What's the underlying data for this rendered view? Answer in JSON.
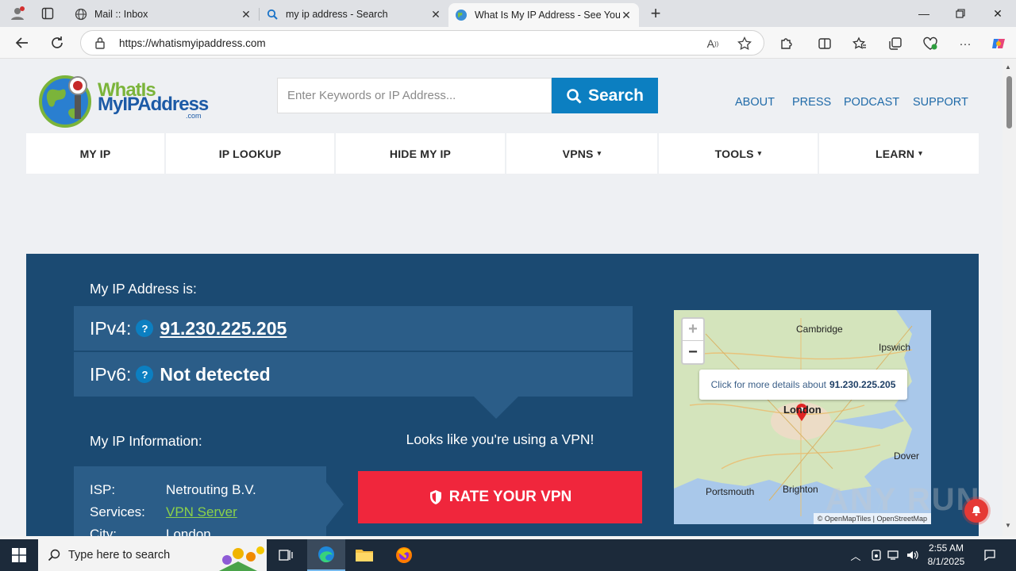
{
  "browser": {
    "tabs": [
      {
        "title": "Mail :: Inbox",
        "active": false
      },
      {
        "title": "my ip address - Search",
        "active": false
      },
      {
        "title": "What Is My IP Address - See Your",
        "active": true
      }
    ],
    "url": "https://whatismyipaddress.com"
  },
  "site": {
    "logo": {
      "line1": "WhatIs",
      "line2": "MyIPAddress",
      "line3": ".com"
    },
    "search": {
      "placeholder": "Enter Keywords or IP Address...",
      "button_label": "Search"
    },
    "top_links": [
      "ABOUT",
      "PRESS",
      "PODCAST",
      "SUPPORT"
    ],
    "nav": [
      {
        "label": "MY IP",
        "caret": false
      },
      {
        "label": "IP LOOKUP",
        "caret": false
      },
      {
        "label": "HIDE MY IP",
        "caret": false
      },
      {
        "label": "VPNS",
        "caret": true
      },
      {
        "label": "TOOLS",
        "caret": true
      },
      {
        "label": "LEARN",
        "caret": true
      }
    ],
    "caret_glyph": "▾"
  },
  "hero": {
    "heading": "My IP Address is:",
    "ipv4_label": "IPv4:",
    "ipv4_value": "91.230.225.205",
    "ipv6_label": "IPv6:",
    "ipv6_value": "Not detected",
    "help_glyph": "?",
    "info_heading": "My IP Information:",
    "info": [
      {
        "key": "ISP:",
        "value": "Netrouting B.V.",
        "link": false
      },
      {
        "key": "Services:",
        "value": "VPN Server",
        "link": true
      },
      {
        "key": "City:",
        "value": "London",
        "link": false
      }
    ],
    "vpn_message": "Looks like you're using a VPN!",
    "rate_button": "RATE YOUR VPN"
  },
  "map": {
    "popup_prefix": "Click for more details about",
    "popup_ip": "91.230.225.205",
    "zoom_in": "+",
    "zoom_out": "−",
    "labels": [
      "Cambridge",
      "Ipswich",
      "London",
      "Dover",
      "Portsmouth",
      "Brighton"
    ],
    "attribution": "© OpenMapTiles | OpenStreetMap"
  },
  "watermark": "ANY RUN",
  "taskbar": {
    "search_placeholder": "Type here to search",
    "time": "2:55 AM",
    "date": "8/1/2025"
  }
}
